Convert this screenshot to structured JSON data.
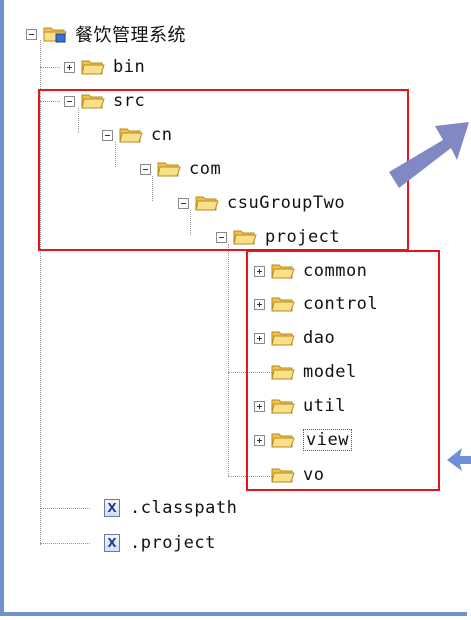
{
  "tree": {
    "root": {
      "label": "餐饮管理系统",
      "icon": "project-folder-icon"
    },
    "nodes": [
      {
        "id": "bin",
        "label": "bin",
        "toggle": "plus"
      },
      {
        "id": "src",
        "label": "src",
        "toggle": "minus"
      },
      {
        "id": "cn",
        "label": "cn",
        "toggle": "minus"
      },
      {
        "id": "com",
        "label": "com",
        "toggle": "minus"
      },
      {
        "id": "csuGroupTwo",
        "label": "csuGroupTwo",
        "toggle": "minus"
      },
      {
        "id": "project",
        "label": "project",
        "toggle": "minus"
      },
      {
        "id": "common",
        "label": "common",
        "toggle": "plus"
      },
      {
        "id": "control",
        "label": "control",
        "toggle": "plus"
      },
      {
        "id": "dao",
        "label": "dao",
        "toggle": "plus"
      },
      {
        "id": "model",
        "label": "model",
        "toggle": "none"
      },
      {
        "id": "util",
        "label": "util",
        "toggle": "plus"
      },
      {
        "id": "view",
        "label": "view",
        "toggle": "plus",
        "selected": true
      },
      {
        "id": "vo",
        "label": "vo",
        "toggle": "none"
      }
    ],
    "files": [
      {
        "label": ".classpath",
        "icon": "x-file-icon",
        "glyph": "X"
      },
      {
        "label": ".project",
        "icon": "x-file-icon",
        "glyph": "X"
      }
    ]
  },
  "colors": {
    "highlight_box": "#e8141a",
    "arrow": "#8189c4",
    "folder": "#f3c24a",
    "frame": "#6f93c9"
  }
}
